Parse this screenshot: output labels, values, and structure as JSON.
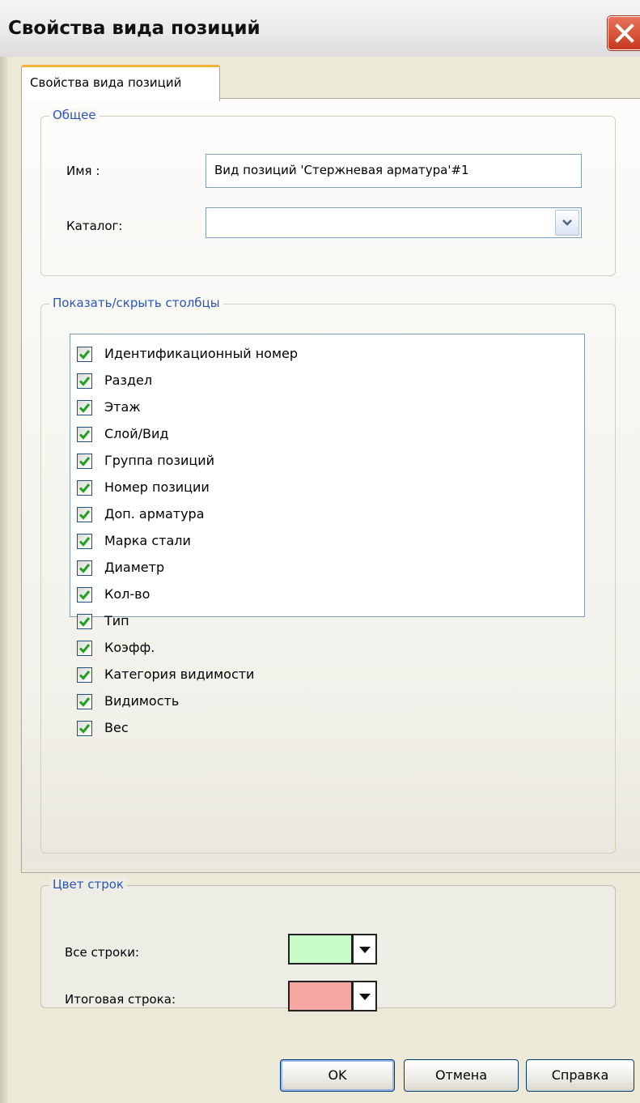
{
  "window": {
    "title": "Свойства вида позиций"
  },
  "tab": {
    "label": "Свойства вида позиций"
  },
  "general": {
    "legend": "Общее",
    "name_label": "Имя :",
    "name_value": "Вид позиций 'Стержневая арматура'#1",
    "catalog_label": "Каталог:",
    "catalog_value": ""
  },
  "columns": {
    "legend": "Показать/скрыть столбцы",
    "items": [
      {
        "label": "Идентификационный номер",
        "checked": true
      },
      {
        "label": "Раздел",
        "checked": true
      },
      {
        "label": "Этаж",
        "checked": true
      },
      {
        "label": "Слой/Вид",
        "checked": true
      },
      {
        "label": "Группа позиций",
        "checked": true
      },
      {
        "label": "Номер позиции",
        "checked": true
      },
      {
        "label": "Доп. арматура",
        "checked": true
      },
      {
        "label": "Марка стали",
        "checked": true
      },
      {
        "label": "Диаметр",
        "checked": true
      },
      {
        "label": "Кол-во",
        "checked": true
      },
      {
        "label": "Тип",
        "checked": true
      },
      {
        "label": "Коэфф.",
        "checked": true
      },
      {
        "label": "Категория видимости",
        "checked": true
      },
      {
        "label": "Видимость",
        "checked": true
      },
      {
        "label": "Вес",
        "checked": true
      }
    ]
  },
  "row_colors": {
    "legend": "Цвет строк",
    "all_rows_label": "Все строки:",
    "all_rows_color": "#c8fdc8",
    "total_row_label": "Итоговая строка:",
    "total_row_color": "#f7a7a2"
  },
  "buttons": {
    "ok": "OK",
    "cancel": "Отмена",
    "help": "Справка"
  },
  "colors": {
    "check_green": "#21a121",
    "legend_blue": "#2a55b8",
    "tab_accent": "#f2b33c"
  }
}
